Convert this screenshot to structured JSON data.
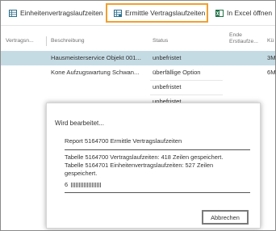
{
  "toolbar": {
    "items": [
      {
        "label": "Einheitenvertragslaufzeiten",
        "icon": "grid-table-icon"
      },
      {
        "label": "Ermittle Vertragslaufzeiten",
        "icon": "calc-grid-icon"
      },
      {
        "label": "In Excel öffnen",
        "icon": "excel-icon"
      }
    ],
    "highlight_color": "#f0a030"
  },
  "table": {
    "columns": {
      "c1": "Vertragsn...",
      "c2": "Beschreibung",
      "c3": "Status",
      "c4a": "Ende",
      "c4b": "Erstlaufze...",
      "c5": "Kü"
    },
    "rows": [
      {
        "beschreibung": "Hausmeisterservice Objekt 001...",
        "status": "unbefristet",
        "c5": "3M",
        "selected": true
      },
      {
        "beschreibung": "Kone Aufzugswartung Schwan...",
        "status": "überfällige Option",
        "c5": "6M",
        "selected": false
      },
      {
        "beschreibung": "",
        "status": "unbefristet",
        "c5": "",
        "selected": false
      },
      {
        "beschreibung": "",
        "status": "unbefristet",
        "c5": "",
        "selected": false
      }
    ],
    "selected_color": "#c5dbe4"
  },
  "dialog": {
    "title": "Wird bearbeitet...",
    "report": "Report 5164700 Ermittle Vertragslaufzeiten",
    "message_line1": "Tabelle 5164700 Vertragslaufzeiten: 418 Zeilen gespeichert.",
    "message_line2": "Tabelle 5164701 Einheitenvertragslaufzeiten: 527 Zeilen gespeichert.",
    "progress_value": "6",
    "cancel_label": "Abbrechen"
  }
}
